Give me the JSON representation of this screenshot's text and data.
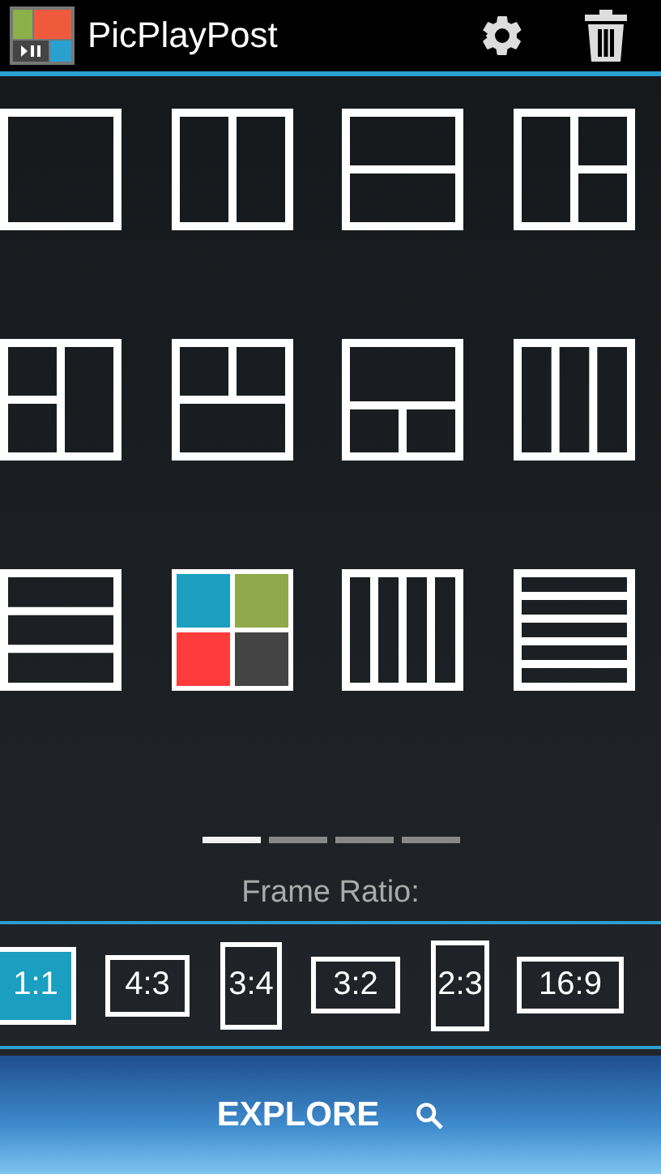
{
  "app_bar": {
    "title": "PicPlayPost"
  },
  "templates": [
    {
      "kind": "single"
    },
    {
      "kind": "two-columns"
    },
    {
      "kind": "two-rows"
    },
    {
      "kind": "left-column-right-rows"
    },
    {
      "kind": "left-rows-right-column"
    },
    {
      "kind": "top-columns-bottom-full"
    },
    {
      "kind": "top-full-bottom-columns"
    },
    {
      "kind": "three-columns"
    },
    {
      "kind": "three-rows"
    },
    {
      "kind": "color-grid"
    },
    {
      "kind": "four-columns"
    },
    {
      "kind": "five-rows"
    }
  ],
  "pages": [
    {
      "selected": true
    },
    {
      "selected": false
    },
    {
      "selected": false
    },
    {
      "selected": false
    }
  ],
  "ratio_label": "Frame Ratio:",
  "ratios": [
    {
      "label": "1:1",
      "kind": "square",
      "selected": true
    },
    {
      "label": "4:3",
      "kind": "landscape",
      "selected": false
    },
    {
      "label": "3:4",
      "kind": "portrait",
      "selected": false
    },
    {
      "label": "3:2",
      "kind": "wide",
      "selected": false
    },
    {
      "label": "2:3",
      "kind": "tall",
      "selected": false
    },
    {
      "label": "16:9",
      "kind": "widest",
      "selected": false
    }
  ],
  "explore": {
    "label": "EXPLORE"
  }
}
